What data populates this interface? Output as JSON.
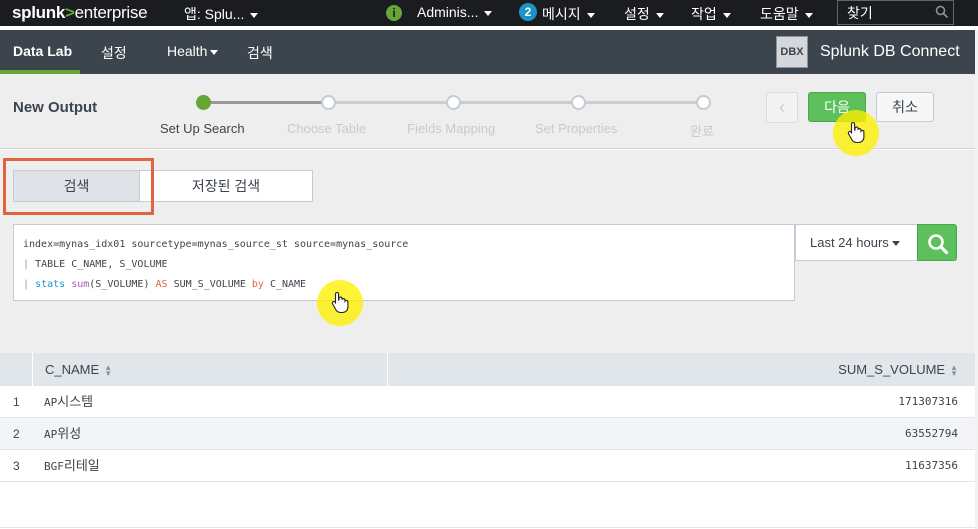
{
  "topbar": {
    "logo_splunk": "splunk",
    "logo_arrow": ">",
    "logo_product": "enterprise",
    "app_menu": "앱: Splu...",
    "info_icon": "i",
    "user_menu": "Adminis...",
    "messages_count": "2",
    "messages_label": "메시지",
    "settings_label": "설정",
    "activity_label": "작업",
    "help_label": "도움말",
    "find_placeholder": "찾기"
  },
  "appbar": {
    "items": [
      "Data Lab",
      "설정",
      "Health",
      "검색"
    ],
    "dbx_badge": "DBX",
    "app_title": "Splunk DB Connect"
  },
  "header": {
    "title": "New Output",
    "steps": [
      "Set Up Search",
      "Choose Table",
      "Fields Mapping",
      "Set Properties",
      "완료"
    ],
    "current_step_index": 0,
    "prev_label": "‹",
    "next_label": "다음",
    "cancel_label": "취소"
  },
  "search_mode": {
    "tabs": [
      "검색",
      "저장된 검색"
    ],
    "active": "검색"
  },
  "query": {
    "line1": "index=mynas_idx01 sourcetype=mynas_source_st source=mynas_source",
    "line2_pipe": "|",
    "line2_cmd": "TABLE",
    "line2_rest": "C_NAME, S_VOLUME",
    "line3_pipe": "|",
    "line3_cmd": "stats",
    "line3_fn": "sum",
    "line3_arg": "(S_VOLUME)",
    "line3_as": "AS",
    "line3_alias": "SUM_S_VOLUME",
    "line3_by": "by",
    "line3_field": "C_NAME"
  },
  "time_range": "Last 24 hours",
  "table": {
    "columns": [
      "C_NAME",
      "SUM_S_VOLUME"
    ],
    "rows": [
      {
        "index": "1",
        "prefix": "AP",
        "name": "시스템",
        "value": "171307316"
      },
      {
        "index": "2",
        "prefix": "AP",
        "name": "위성",
        "value": "63552794"
      },
      {
        "index": "3",
        "prefix": "BGF",
        "name": "리테일",
        "value": "11637356"
      }
    ]
  },
  "icons": {
    "search": "search-icon",
    "caret": "caret-down-icon",
    "sort": "sort-icon",
    "pointer": "hand-pointer-icon"
  },
  "colors": {
    "topbar": "#1a1c20",
    "appbar": "#3c444d",
    "brand_green": "#65a637",
    "primary_button": "#5cc05c",
    "highlight_box": "#e0653f",
    "cursor_highlight": "#fff000"
  }
}
